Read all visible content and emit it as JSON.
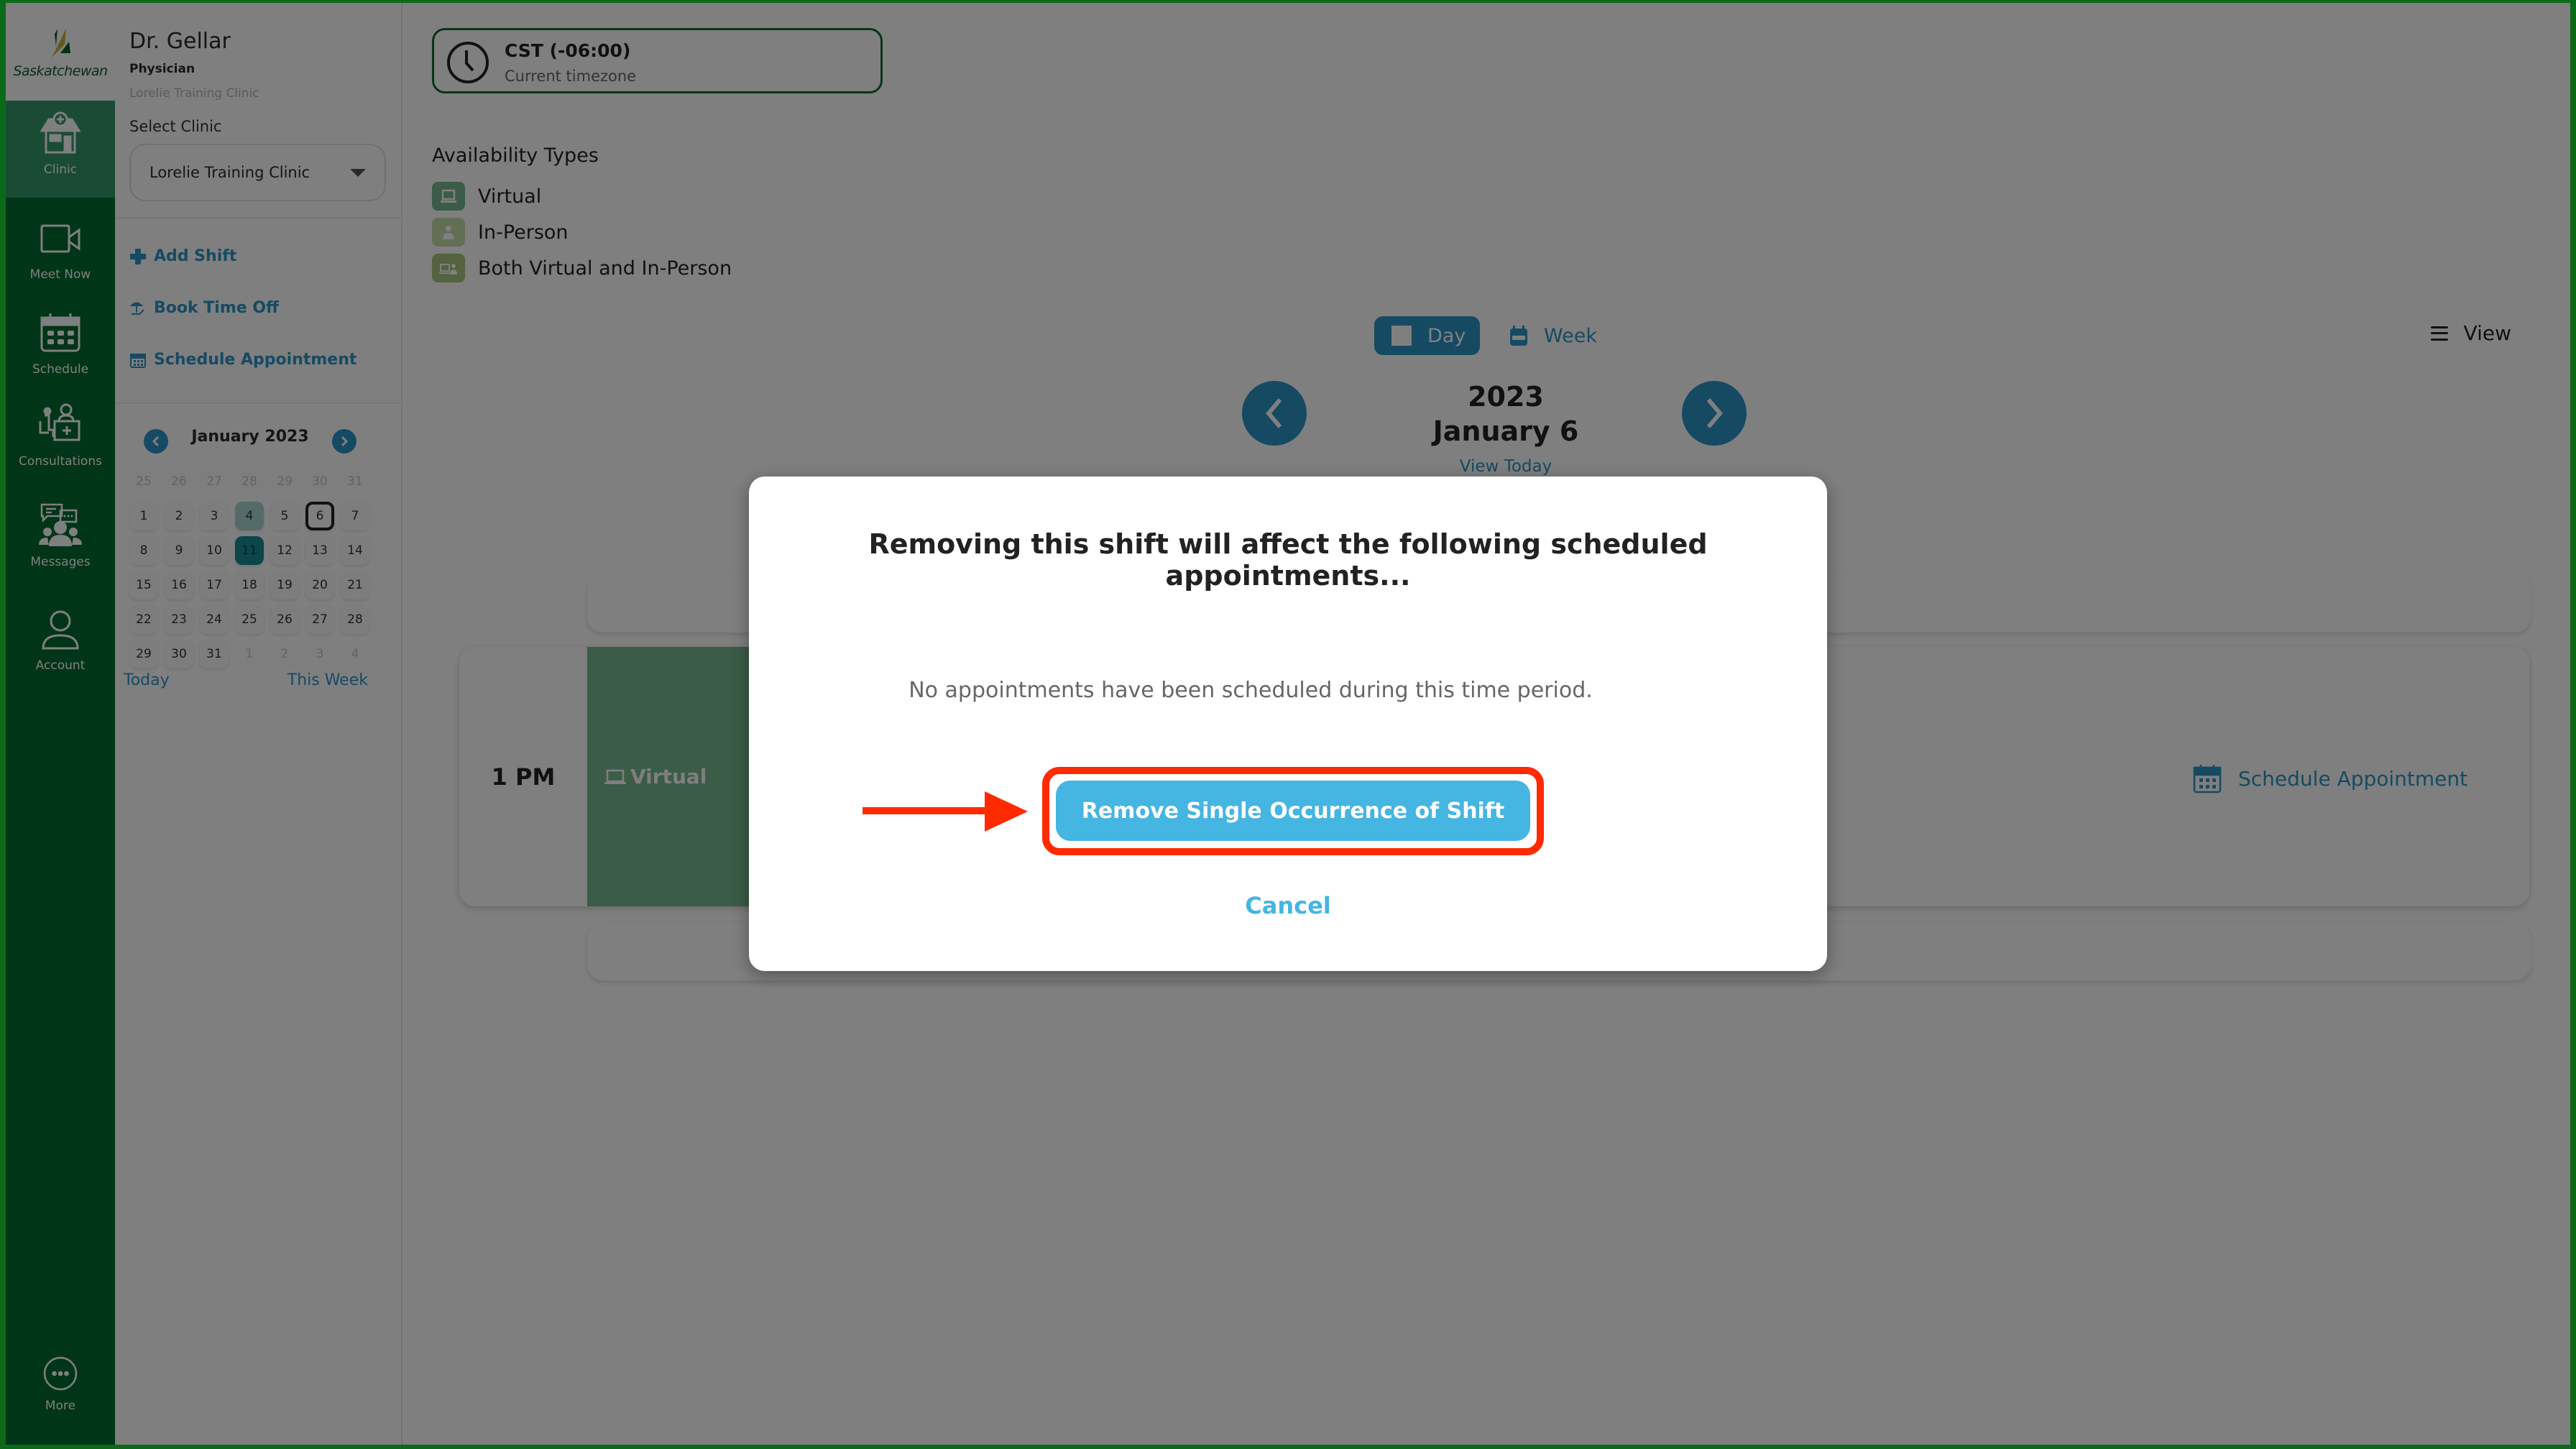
{
  "brand": {
    "logo_text": "Saskatchewan",
    "frame_color": "#0b6a1a"
  },
  "nav": {
    "items": [
      {
        "label": "Clinic",
        "icon": "clinic-icon",
        "active": true
      },
      {
        "label": "Meet Now",
        "icon": "video-camera-icon",
        "active": false
      },
      {
        "label": "Schedule",
        "icon": "calendar-icon",
        "active": false
      },
      {
        "label": "Consultations",
        "icon": "consultation-icon",
        "active": false
      },
      {
        "label": "Messages",
        "icon": "messages-icon",
        "active": false
      },
      {
        "label": "Account",
        "icon": "account-icon",
        "active": false
      }
    ],
    "more_label": "More"
  },
  "profile": {
    "name": "Dr. Gellar",
    "role": "Physician",
    "clinic": "Lorelie Training Clinic"
  },
  "clinic_select": {
    "label": "Select Clinic",
    "value": "Lorelie Training Clinic"
  },
  "actions": {
    "add_shift": "Add Shift",
    "book_time_off": "Book Time Off",
    "schedule_appointment": "Schedule Appointment"
  },
  "mini_calendar": {
    "month_label": "January 2023",
    "weeks": [
      [
        {
          "d": "25",
          "m": 1
        },
        {
          "d": "26",
          "m": 1
        },
        {
          "d": "27",
          "m": 1
        },
        {
          "d": "28",
          "m": 1
        },
        {
          "d": "29",
          "m": 1
        },
        {
          "d": "30",
          "m": 1
        },
        {
          "d": "31",
          "m": 1
        }
      ],
      [
        {
          "d": "1"
        },
        {
          "d": "2"
        },
        {
          "d": "3"
        },
        {
          "d": "4",
          "s": "shift"
        },
        {
          "d": "5"
        },
        {
          "d": "6",
          "s": "selected"
        },
        {
          "d": "7"
        }
      ],
      [
        {
          "d": "8"
        },
        {
          "d": "9"
        },
        {
          "d": "10"
        },
        {
          "d": "11",
          "s": "today"
        },
        {
          "d": "12"
        },
        {
          "d": "13"
        },
        {
          "d": "14"
        }
      ],
      [
        {
          "d": "15"
        },
        {
          "d": "16"
        },
        {
          "d": "17"
        },
        {
          "d": "18"
        },
        {
          "d": "19"
        },
        {
          "d": "20"
        },
        {
          "d": "21"
        }
      ],
      [
        {
          "d": "22"
        },
        {
          "d": "23"
        },
        {
          "d": "24"
        },
        {
          "d": "25"
        },
        {
          "d": "26"
        },
        {
          "d": "27"
        },
        {
          "d": "28"
        }
      ],
      [
        {
          "d": "29"
        },
        {
          "d": "30"
        },
        {
          "d": "31"
        },
        {
          "d": "1",
          "m": 1
        },
        {
          "d": "2",
          "m": 1
        },
        {
          "d": "3",
          "m": 1
        },
        {
          "d": "4",
          "m": 1
        }
      ]
    ],
    "today_link": "Today",
    "this_week_link": "This Week"
  },
  "timezone": {
    "title": "CST (-06:00)",
    "subtitle": "Current timezone"
  },
  "availability": {
    "heading": "Availability Types",
    "types": [
      {
        "label": "Virtual",
        "color": "#76b88d",
        "icon": "laptop-icon"
      },
      {
        "label": "In-Person",
        "color": "#c5dfa8",
        "icon": "person-icon"
      },
      {
        "label": "Both Virtual and In-Person",
        "color": "#a3c77f",
        "icon": "laptop-person-icon"
      }
    ]
  },
  "view_toggle": {
    "day": "Day",
    "week": "Week",
    "selected": "Day",
    "view_menu": "View"
  },
  "date_nav": {
    "year": "2023",
    "date": "January 6",
    "view_today": "View Today"
  },
  "schedule": {
    "hour_label": "1 PM",
    "shift_type": "Virtual",
    "schedule_appointment": "Schedule Appointment"
  },
  "dialog": {
    "title": "Removing this shift will affect the following scheduled appointments...",
    "message": "No appointments have been scheduled during this time period.",
    "primary_button": "Remove Single Occurrence of Shift",
    "cancel": "Cancel",
    "highlight_color": "#ff2a00"
  },
  "colors": {
    "accent": "#2c95c6",
    "button": "#45b5e2",
    "rail": "#006b2e",
    "rail_active": "#35966a"
  }
}
